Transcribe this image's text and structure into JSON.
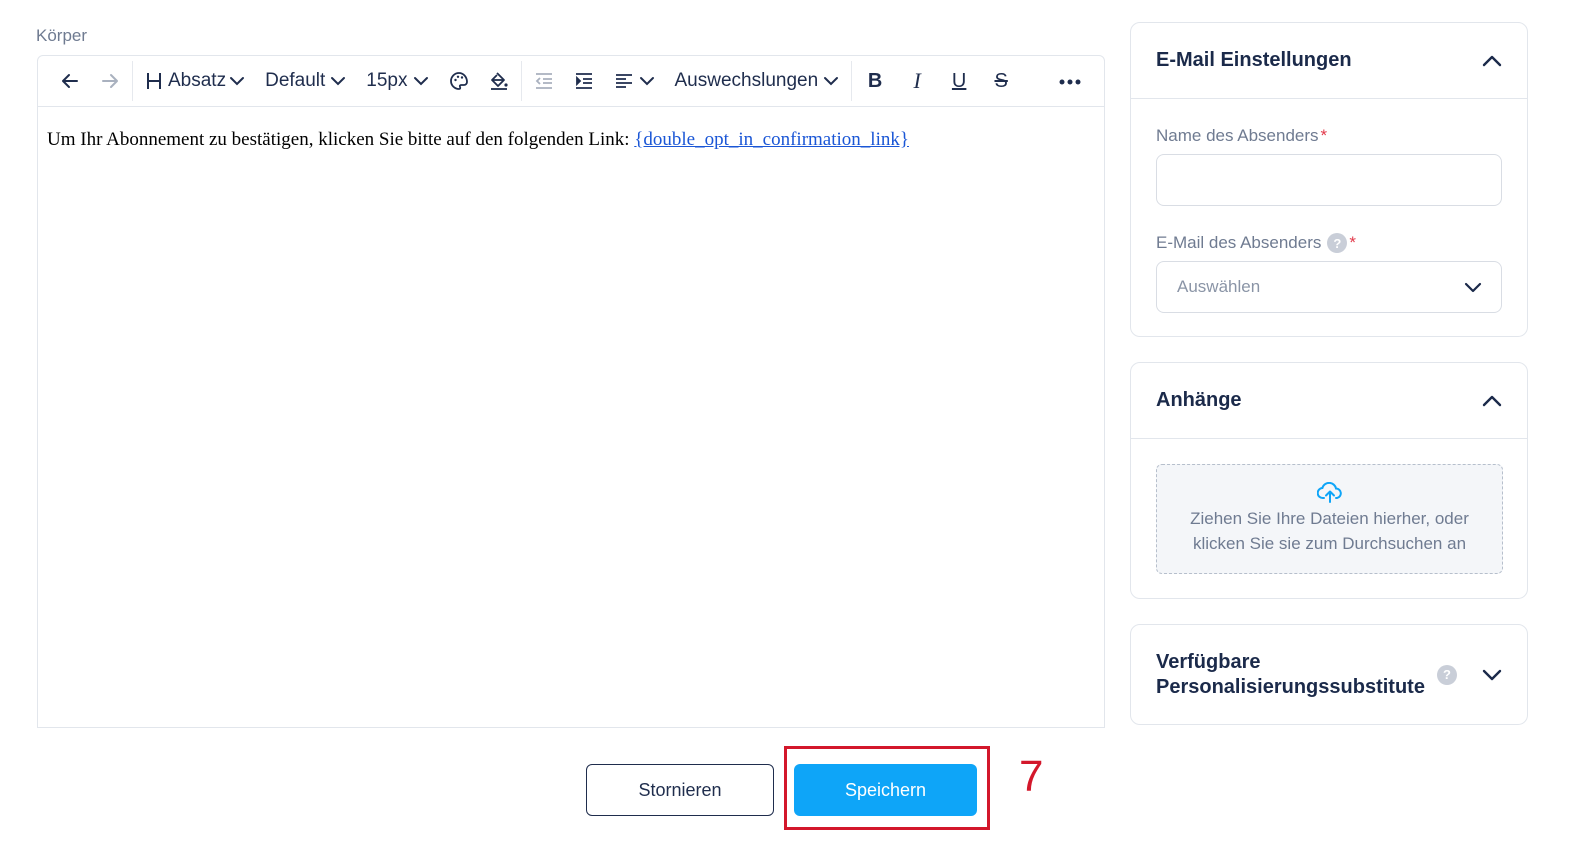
{
  "body_label": "Körper",
  "toolbar": {
    "undo_icon": "arrow-left-icon",
    "redo_icon": "arrow-right-icon",
    "block_type": "Absatz",
    "font_family": "Default",
    "font_size": "15px",
    "replacements": "Auswechslungen",
    "bold": "B",
    "italic": "I",
    "underline": "U",
    "strike": "S"
  },
  "editor": {
    "text": "Um Ihr Abonnement zu bestätigen, klicken Sie bitte auf den folgenden Link: ",
    "link": "{double_opt_in_confirmation_link}"
  },
  "email_settings": {
    "title": "E-Mail Einstellungen",
    "sender_name_label": "Name des Absenders",
    "sender_email_label": "E-Mail des Absenders",
    "required_mark": "*",
    "help": "?",
    "sender_email_placeholder": "Auswählen"
  },
  "attachments": {
    "title": "Anhänge",
    "drop_line1": "Ziehen Sie Ihre Dateien hierher, oder",
    "drop_line2": "klicken Sie sie zum Durchsuchen an"
  },
  "personalization": {
    "title_line1": "Verfügbare",
    "title_line2": "Personalisierungssubstitute",
    "help": "?"
  },
  "buttons": {
    "cancel": "Stornieren",
    "save": "Speichern"
  },
  "annotation": {
    "step": "7",
    "color": "#d3172b"
  },
  "colors": {
    "primary": "#0ea5f8",
    "text_dark": "#1f2d4d",
    "link": "#1a56d6"
  }
}
